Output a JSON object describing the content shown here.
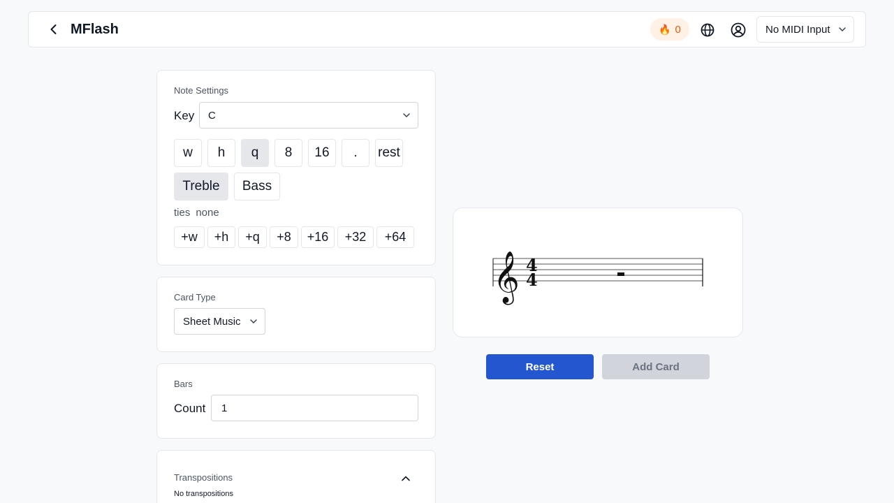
{
  "header": {
    "title": "MFlash",
    "streak_icon": "🔥",
    "streak_count": "0",
    "midi_input": "No MIDI Input"
  },
  "note_settings": {
    "title": "Note Settings",
    "key_label": "Key",
    "key_value": "C",
    "durations": [
      "w",
      "h",
      "q",
      "8",
      "16",
      ".",
      "rest"
    ],
    "active_duration": "q",
    "clefs": [
      "Treble",
      "Bass"
    ],
    "active_clef": "Treble",
    "ties_label": "ties",
    "ties_value": "none",
    "tie_buttons": [
      "+w",
      "+h",
      "+q",
      "+8",
      "+16",
      "+32",
      "+64"
    ]
  },
  "card_type": {
    "title": "Card Type",
    "value": "Sheet Music"
  },
  "bars": {
    "title": "Bars",
    "count_label": "Count",
    "count_value": "1"
  },
  "transpositions": {
    "title": "Transpositions",
    "empty_text": "No transpositions"
  },
  "preview": {
    "clef": "treble",
    "time_signature_top": "4",
    "time_signature_bottom": "4",
    "content": "whole rest"
  },
  "actions": {
    "reset_label": "Reset",
    "add_card_label": "Add Card"
  },
  "colors": {
    "primary": "#2456d0",
    "disabled_bg": "#d1d5db",
    "streak_bg": "#fff1e6",
    "streak_text": "#ea580c",
    "page_bg": "#f8f9fb"
  }
}
